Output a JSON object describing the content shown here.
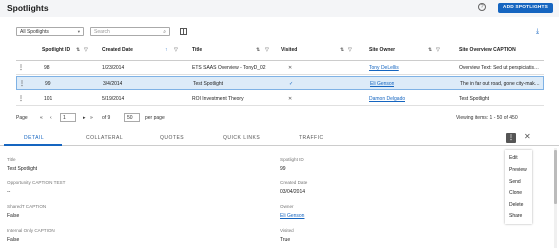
{
  "header": {
    "title": "Spotlights",
    "add_button": "ADD SPOTLIGHTS"
  },
  "toolbar": {
    "view_value": "All Spotlights",
    "search_placeholder": "Search"
  },
  "grid": {
    "columns": [
      "Spotlight ID",
      "Created Date",
      "Title",
      "Visited",
      "Site Owner",
      "Site Overview CAPTION"
    ],
    "rows": [
      {
        "id": "98",
        "created": "1/23/2014",
        "title": "ETS SAAS Overview - TonyD_02",
        "visited": "✕",
        "owner": "Tony DeLellis",
        "overview": "Overview Text: Sed ut perspiciatis…"
      },
      {
        "id": "99",
        "created": "3/4/2014",
        "title": "Test Spotlight",
        "visited": "✓",
        "owner": "Eli Genson",
        "overview": "The in far out road, gone city-mak…"
      },
      {
        "id": "101",
        "created": "5/19/2014",
        "title": "ROI Investment Theory",
        "visited": "✕",
        "owner": "Damon Delgado",
        "overview": "Test Spotlight"
      }
    ]
  },
  "pager": {
    "page_label": "Page",
    "page_value": "1",
    "of_label": "of 9",
    "page_size": "50",
    "per_page": "per page",
    "viewing": "Viewing items: 1 - 50 of 450"
  },
  "tabs": [
    "DETAIL",
    "COLLATERAL",
    "QUOTES",
    "QUICK LINKS",
    "TRAFFIC"
  ],
  "detail": {
    "left": [
      {
        "label": "Title",
        "value": "Test Spotlight"
      },
      {
        "label": "Opportunity CAPTION TEST",
        "value": "--"
      },
      {
        "label": "SharedT CAPTION",
        "value": "False"
      },
      {
        "label": "Internal Only CAPTION",
        "value": "False"
      }
    ],
    "right": [
      {
        "label": "Spotlight ID",
        "value": "99"
      },
      {
        "label": "Created Date",
        "value": "03/04/2014"
      },
      {
        "label": "Owner",
        "value": "Eli Genson"
      },
      {
        "label": "Visited",
        "value": "True"
      }
    ]
  },
  "menu": [
    "Edit",
    "Preview",
    "Send",
    "Clone",
    "Delete",
    "Share"
  ],
  "colors": {
    "accent": "#1565c0",
    "selected_row": "#ddebf8"
  }
}
